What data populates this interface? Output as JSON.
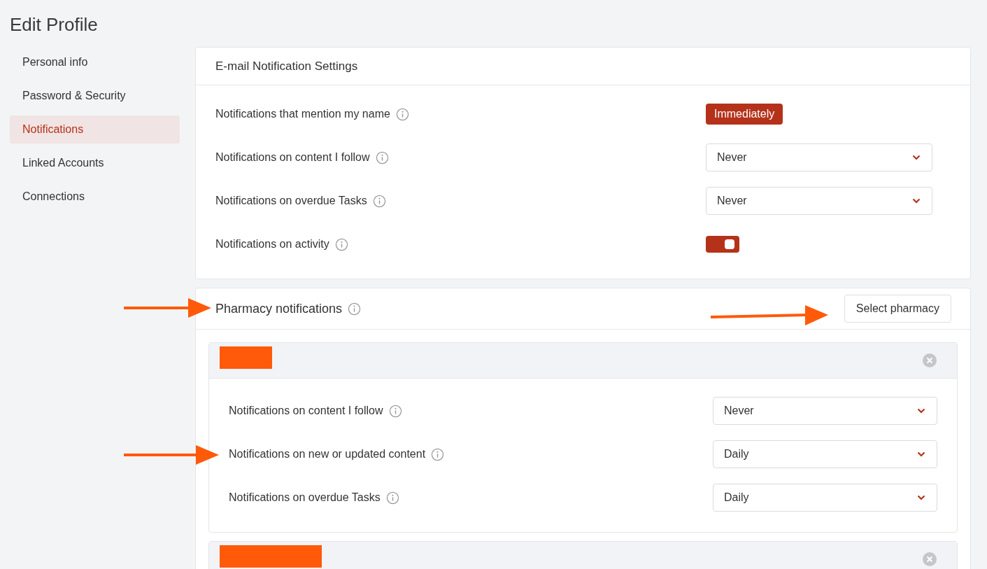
{
  "page": {
    "title": "Edit Profile"
  },
  "sidebar": {
    "items": [
      {
        "label": "Personal info",
        "selected": false
      },
      {
        "label": "Password & Security",
        "selected": false
      },
      {
        "label": "Notifications",
        "selected": true
      },
      {
        "label": "Linked Accounts",
        "selected": false
      },
      {
        "label": "Connections",
        "selected": false
      }
    ]
  },
  "email_settings": {
    "title": "E-mail Notification Settings",
    "rows": [
      {
        "kind": "badge",
        "label": "Notifications that mention my name",
        "value": "Immediately"
      },
      {
        "kind": "dropdown",
        "label": "Notifications on content I follow",
        "value": "Never"
      },
      {
        "kind": "dropdown",
        "label": "Notifications on overdue Tasks",
        "value": "Never"
      },
      {
        "kind": "toggle",
        "label": "Notifications on activity",
        "on": true
      }
    ]
  },
  "pharmacy": {
    "title": "Pharmacy notifications",
    "button": "Select pharmacy",
    "groups": [
      {
        "expanded": true,
        "rows": [
          {
            "kind": "dropdown",
            "label": "Notifications on content I follow",
            "value": "Never"
          },
          {
            "kind": "dropdown",
            "label": "Notifications on new or updated content",
            "value": "Daily"
          },
          {
            "kind": "dropdown",
            "label": "Notifications on overdue Tasks",
            "value": "Daily"
          }
        ]
      },
      {
        "expanded": false
      }
    ]
  }
}
